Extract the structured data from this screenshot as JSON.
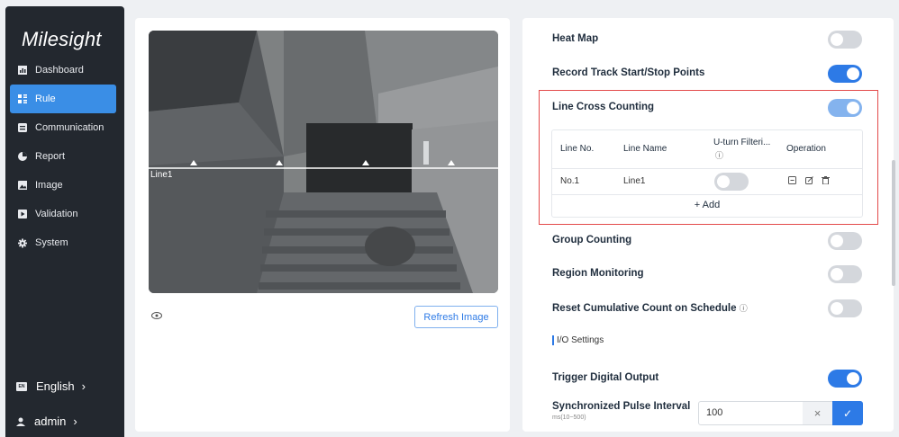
{
  "brand": "Milesight",
  "sidebar": {
    "items": [
      {
        "label": "Dashboard",
        "icon": "bar-chart-icon"
      },
      {
        "label": "Rule",
        "icon": "rule-grid-icon",
        "active": true
      },
      {
        "label": "Communication",
        "icon": "communication-icon"
      },
      {
        "label": "Report",
        "icon": "pie-chart-icon"
      },
      {
        "label": "Image",
        "icon": "image-icon"
      },
      {
        "label": "Validation",
        "icon": "validation-icon"
      },
      {
        "label": "System",
        "icon": "gear-icon"
      }
    ],
    "language": "English",
    "user": "admin"
  },
  "camera": {
    "line_label": "Line1",
    "refresh_label": "Refresh Image"
  },
  "settings": {
    "heat_map": {
      "label": "Heat Map",
      "on": false
    },
    "record_track": {
      "label": "Record Track Start/Stop Points",
      "on": true
    },
    "line_cross": {
      "label": "Line Cross Counting",
      "on": true
    },
    "table": {
      "headers": {
        "line_no": "Line No.",
        "line_name": "Line Name",
        "uturn": "U-turn Filteri...",
        "operation": "Operation"
      },
      "rows": [
        {
          "line_no": "No.1",
          "line_name": "Line1",
          "uturn_on": false
        }
      ],
      "add_label": "+ Add"
    },
    "group_counting": {
      "label": "Group Counting",
      "on": false
    },
    "region_monitoring": {
      "label": "Region Monitoring",
      "on": false
    },
    "reset_cumulative": {
      "label": "Reset Cumulative Count on Schedule",
      "on": false
    },
    "io_section": "I/O Settings",
    "trigger_digital": {
      "label": "Trigger Digital Output",
      "on": true
    },
    "pulse": {
      "label": "Synchronized Pulse Interval",
      "sub": "ms(10~500)",
      "value": "100"
    }
  },
  "colors": {
    "accent": "#2d7ae6",
    "sidebar_bg": "#23282f",
    "highlight_border": "#e34a4a"
  }
}
